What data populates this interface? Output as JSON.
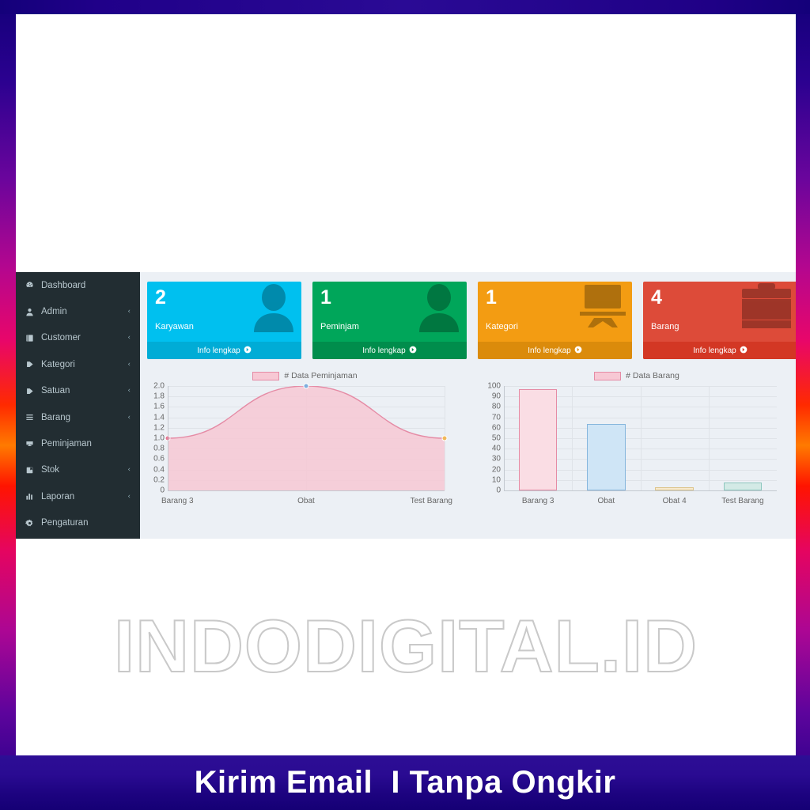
{
  "promo": {
    "banner_text": "Kirim Email  I Tanpa Ongkir",
    "watermark": "INDODIGITAL.ID",
    "frame_color": "#15067d",
    "accent_gradient": [
      "#14007a",
      "#b4068f",
      "#ff2a00",
      "#ff7a00",
      "#ab0694",
      "#1a0084"
    ]
  },
  "app": {
    "sidebar": {
      "background": "#222d32",
      "items": [
        {
          "label": "Dashboard",
          "icon": "dashboard-icon",
          "caret": ""
        },
        {
          "label": "Admin",
          "icon": "user-icon",
          "caret": "‹"
        },
        {
          "label": "Customer",
          "icon": "book-icon",
          "caret": "‹"
        },
        {
          "label": "Kategori",
          "icon": "tag-icon",
          "caret": "‹"
        },
        {
          "label": "Satuan",
          "icon": "tag-icon",
          "caret": "‹"
        },
        {
          "label": "Barang",
          "icon": "list-icon",
          "caret": "‹"
        },
        {
          "label": "Peminjaman",
          "icon": "cart-icon",
          "caret": ""
        },
        {
          "label": "Stok",
          "icon": "box-icon",
          "caret": "‹"
        },
        {
          "label": "Laporan",
          "icon": "chart-bar-icon",
          "caret": "‹"
        },
        {
          "label": "Pengaturan",
          "icon": "gear-icon",
          "caret": ""
        }
      ]
    },
    "cards": [
      {
        "number": "2",
        "label": "Karyawan",
        "footer": "Info lengkap",
        "color": "#00c0ef",
        "icon": "person-icon"
      },
      {
        "number": "1",
        "label": "Peminjam",
        "footer": "Info lengkap",
        "color": "#00a65a",
        "icon": "person-icon"
      },
      {
        "number": "1",
        "label": "Kategori",
        "footer": "Info lengkap",
        "color": "#f39c12",
        "icon": "monitor-icon"
      },
      {
        "number": "4",
        "label": "Barang",
        "footer": "Info lengkap",
        "color": "#dd4b39",
        "icon": "briefcase-icon"
      }
    ]
  },
  "chart_data": [
    {
      "type": "area",
      "title": "# Data Peminjaman",
      "legend": "# Data Peminjaman",
      "legend_position": "top-center",
      "categories": [
        "Barang 3",
        "Obat",
        "Test Barang"
      ],
      "values": [
        1.0,
        2.0,
        1.0
      ],
      "point_colors": [
        "#e8718f",
        "#7eaede",
        "#f0b95a"
      ],
      "line_color": "#e58ba5",
      "fill_color": "#f7c8d4",
      "ylim": [
        0,
        2.0
      ],
      "yticks": [
        "2.0",
        "1.8",
        "1.6",
        "1.4",
        "1.2",
        "1.0",
        "0.8",
        "0.6",
        "0.4",
        "0.2",
        "0"
      ],
      "xlabel": "",
      "ylabel": "",
      "grid": true
    },
    {
      "type": "bar",
      "title": "# Data Barang",
      "legend": "# Data Barang",
      "legend_position": "top-center",
      "categories": [
        "Barang 3",
        "Obat",
        "Obat 4",
        "Test Barang"
      ],
      "values": [
        97,
        64,
        3,
        7.5
      ],
      "bar_colors": [
        "#fadde4",
        "#cfe5f6",
        "#f7ead0",
        "#d3eae6"
      ],
      "bar_borders": [
        "#e58ba5",
        "#86b6dd",
        "#dcc48a",
        "#8ec7bf"
      ],
      "ylim": [
        0,
        100
      ],
      "yticks": [
        "100",
        "90",
        "80",
        "70",
        "60",
        "50",
        "40",
        "30",
        "20",
        "10",
        "0"
      ],
      "xlabel": "",
      "ylabel": "",
      "grid": true
    }
  ]
}
